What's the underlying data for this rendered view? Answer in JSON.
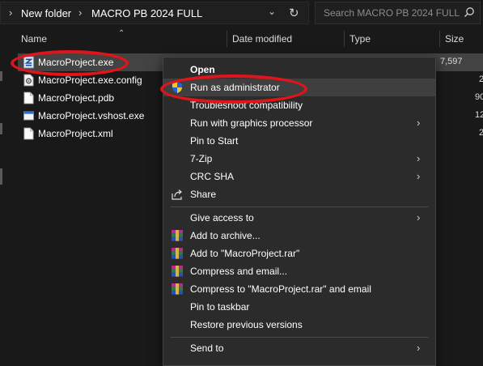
{
  "address": {
    "crumbs": [
      "New folder",
      "MACRO PB 2024 FULL"
    ],
    "search_placeholder": "Search MACRO PB 2024 FULL"
  },
  "columns": [
    "Name",
    "Date modified",
    "Type",
    "Size"
  ],
  "files": [
    {
      "name": "MacroProject.exe",
      "size": "7,597",
      "icon": "exe-app-icon",
      "selected": true
    },
    {
      "name": "MacroProject.exe.config",
      "size": "2",
      "icon": "config-file-icon"
    },
    {
      "name": "MacroProject.pdb",
      "size": "90",
      "icon": "file-icon"
    },
    {
      "name": "MacroProject.vshost.exe",
      "size": "12",
      "icon": "exe-window-icon"
    },
    {
      "name": "MacroProject.xml",
      "size": "2",
      "icon": "file-icon"
    }
  ],
  "menu": {
    "open": "Open",
    "run_as_admin": "Run as administrator",
    "troubleshoot": "Troubleshoot compatibility",
    "run_gpu": "Run with graphics processor",
    "pin_start": "Pin to Start",
    "zip7": "7-Zip",
    "crc": "CRC SHA",
    "share": "Share",
    "give_access": "Give access to",
    "add_archive": "Add to archive...",
    "add_rar": "Add to \"MacroProject.rar\"",
    "compress_email": "Compress and email...",
    "compress_rar_email": "Compress to \"MacroProject.rar\" and email",
    "pin_taskbar": "Pin to taskbar",
    "restore": "Restore previous versions",
    "send_to": "Send to"
  },
  "colors": {
    "highlight_ellipse": "#e0141b",
    "menu_bg": "#2b2b2b",
    "selected_row": "#434343"
  }
}
